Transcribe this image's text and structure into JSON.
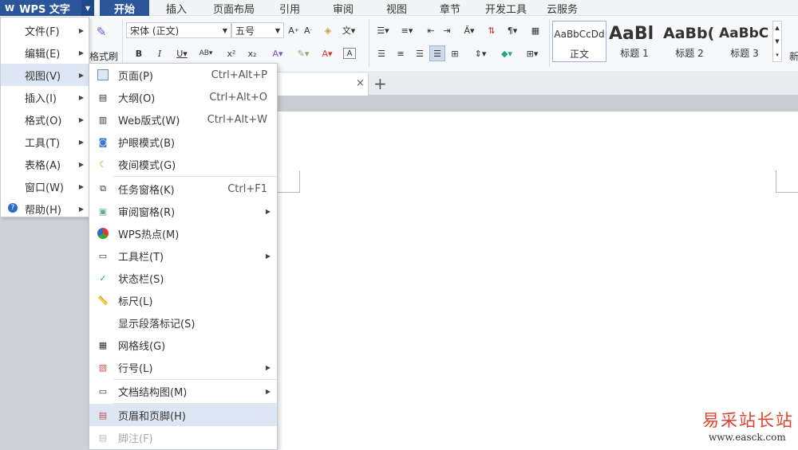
{
  "app": {
    "title": "WPS 文字"
  },
  "tabs": [
    "开始",
    "插入",
    "页面布局",
    "引用",
    "审阅",
    "视图",
    "章节",
    "开发工具",
    "云服务"
  ],
  "ribbon": {
    "font_name": "宋体 (正文)",
    "font_size": "五号",
    "format_painter": "格式刷",
    "styles": [
      {
        "preview": "AaBbCcDd",
        "name": "正文"
      },
      {
        "preview": "AaBl",
        "name": "标题 1"
      },
      {
        "preview": "AaBb(",
        "name": "标题 2"
      },
      {
        "preview": "AaBbC",
        "name": "标题 3"
      }
    ],
    "new_style_partial": "新"
  },
  "main_menu": [
    {
      "label": "文件(F)",
      "has_sub": true
    },
    {
      "label": "编辑(E)",
      "has_sub": true
    },
    {
      "label": "视图(V)",
      "has_sub": true,
      "selected": true
    },
    {
      "label": "插入(I)",
      "has_sub": true
    },
    {
      "label": "格式(O)",
      "has_sub": true
    },
    {
      "label": "工具(T)",
      "has_sub": true
    },
    {
      "label": "表格(A)",
      "has_sub": true
    },
    {
      "label": "窗口(W)",
      "has_sub": true
    },
    {
      "label": "帮助(H)",
      "has_sub": true,
      "icon": "help-icon"
    }
  ],
  "view_menu": [
    {
      "label": "页面(P)",
      "shortcut": "Ctrl+Alt+P",
      "icon": "page-view-icon"
    },
    {
      "label": "大纲(O)",
      "shortcut": "Ctrl+Alt+O",
      "icon": "outline-icon"
    },
    {
      "label": "Web版式(W)",
      "shortcut": "Ctrl+Alt+W",
      "icon": "web-layout-icon"
    },
    {
      "label": "护眼模式(B)",
      "shortcut": "",
      "icon": "eye-care-icon"
    },
    {
      "label": "夜间模式(G)",
      "shortcut": "",
      "icon": "night-mode-icon"
    },
    {
      "label": "任务窗格(K)",
      "shortcut": "Ctrl+F1",
      "icon": "task-pane-icon"
    },
    {
      "label": "审阅窗格(R)",
      "shortcut": "",
      "icon": "review-pane-icon",
      "has_sub": true
    },
    {
      "label": "WPS热点(M)",
      "shortcut": "",
      "icon": "wps-hotspot-icon"
    },
    {
      "label": "工具栏(T)",
      "shortcut": "",
      "icon": "toolbar-icon",
      "has_sub": true
    },
    {
      "label": "状态栏(S)",
      "shortcut": "",
      "icon": "checkmark-icon"
    },
    {
      "label": "标尺(L)",
      "shortcut": "",
      "icon": "ruler-icon"
    },
    {
      "label": "显示段落标记(S)",
      "shortcut": "",
      "icon": ""
    },
    {
      "label": "网格线(G)",
      "shortcut": "",
      "icon": "gridlines-icon"
    },
    {
      "label": "行号(L)",
      "shortcut": "",
      "icon": "line-number-icon",
      "has_sub": true
    },
    {
      "label": "文档结构图(M)",
      "shortcut": "",
      "icon": "doc-map-icon",
      "has_sub": true
    },
    {
      "label": "页眉和页脚(H)",
      "shortcut": "",
      "icon": "header-footer-icon",
      "selected": true
    },
    {
      "label": "脚注(F)",
      "shortcut": "",
      "icon": "footnote-icon",
      "disabled": true
    }
  ],
  "watermark": {
    "text": "易采站长站",
    "url": "www.easck.com"
  },
  "colors": {
    "accent": "#2b579a",
    "menu_highlight": "#dde6f3",
    "watermark": "#d9442b"
  }
}
